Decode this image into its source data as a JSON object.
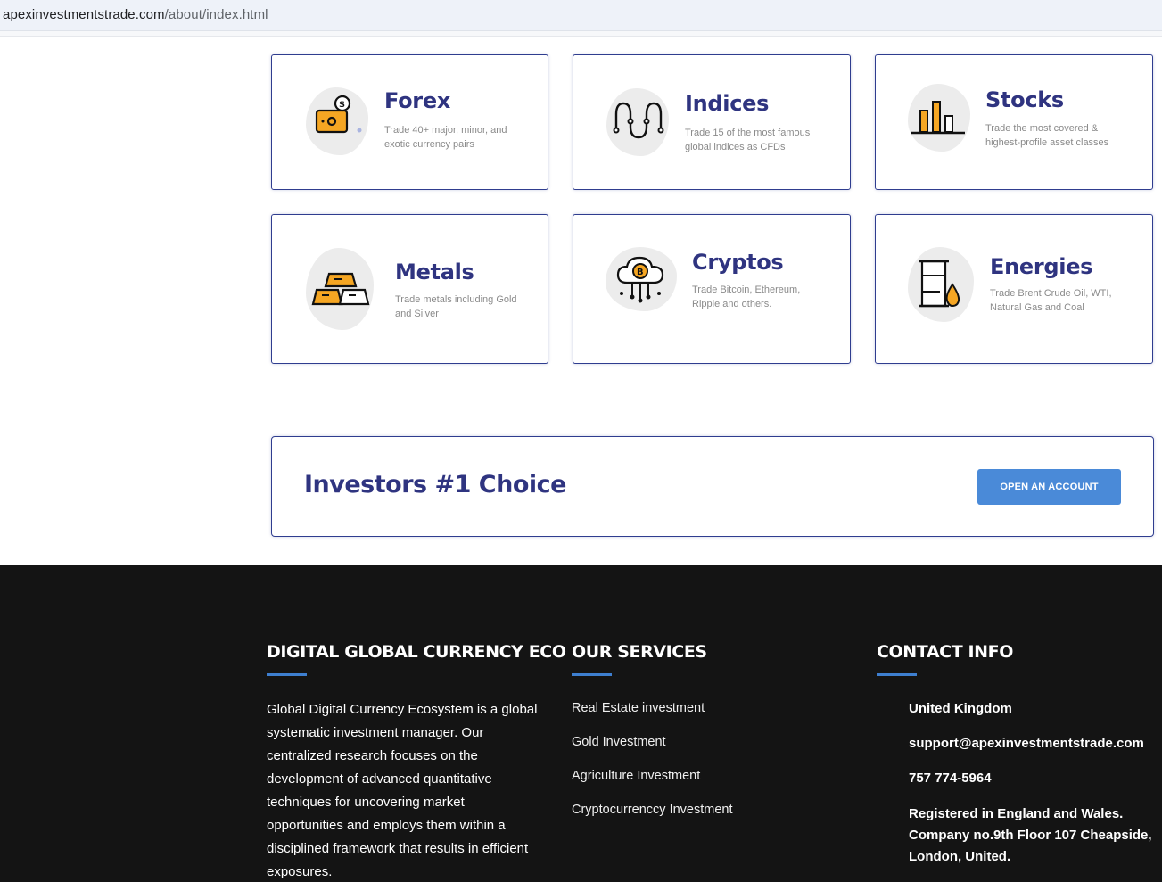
{
  "browser": {
    "url_domain": "apexinvestmentstrade.com",
    "url_path": "/about/index.html"
  },
  "markets": [
    {
      "title": "Forex",
      "desc": "Trade 40+ major, minor, and exotic currency pairs",
      "icon": "forex-wallet-icon"
    },
    {
      "title": "Indices",
      "desc": "Trade 15 of the most famous global indices as CFDs",
      "icon": "indices-wave-icon"
    },
    {
      "title": "Stocks",
      "desc": "Trade the most covered & highest-profile asset classes",
      "icon": "stocks-bar-icon"
    },
    {
      "title": "Metals",
      "desc": "Trade metals including Gold and Silver",
      "icon": "gold-bars-icon"
    },
    {
      "title": "Cryptos",
      "desc": "Trade Bitcoin, Ethereum, Ripple and others.",
      "icon": "bitcoin-cloud-icon"
    },
    {
      "title": "Energies",
      "desc": "Trade Brent Crude Oil, WTI, Natural Gas and Coal",
      "icon": "oil-barrel-icon"
    }
  ],
  "banner": {
    "headline": "Investors #1 Choice",
    "cta_label": "OPEN AN ACCOUNT"
  },
  "footer": {
    "about": {
      "title": "DIGITAL GLOBAL CURRENCY ECO",
      "text": "Global Digital Currency Ecosystem is a global systematic investment manager. Our centralized research focuses on the development of advanced quantitative techniques for uncovering market opportunities and employs them within a disciplined framework that results in efficient exposures."
    },
    "services": {
      "title": "OUR SERVICES",
      "items": [
        "Real Estate investment",
        "Gold Investment",
        "Agriculture Investment",
        "Cryptocurrenccy Investment"
      ]
    },
    "contact": {
      "title": "CONTACT INFO",
      "country": "United Kingdom",
      "email": "support@apexinvestmentstrade.com",
      "phone": "757 774-5964",
      "address": "Registered in England and Wales. Company no.9th Floor 107 Cheapside, London, United."
    }
  },
  "colors": {
    "brand_navy": "#2f3480",
    "accent_blue": "#4a8ad8",
    "footer_bg": "#141414",
    "icon_orange": "#f5a623"
  }
}
